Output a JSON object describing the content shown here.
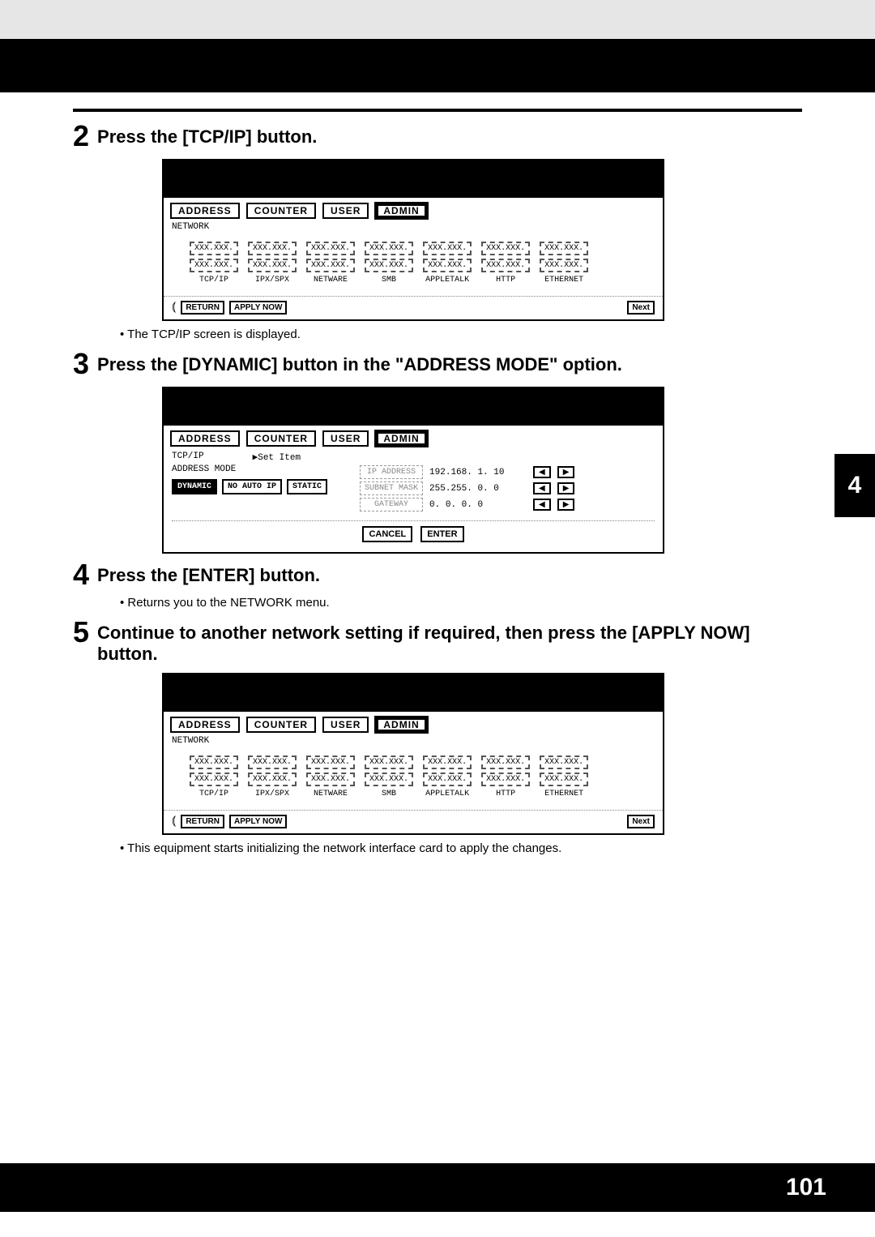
{
  "page_number": "101",
  "side_tab": "4",
  "steps": {
    "s2": {
      "num": "2",
      "title": "Press the [TCP/IP] button.",
      "bullet": "The TCP/IP screen is displayed."
    },
    "s3": {
      "num": "3",
      "title": "Press the [DYNAMIC] button in the \"ADDRESS MODE\" option."
    },
    "s4": {
      "num": "4",
      "title": "Press the [ENTER] button.",
      "bullet": "Returns you to the NETWORK menu."
    },
    "s5": {
      "num": "5",
      "title": "Continue to another network setting if required, then press the [APPLY NOW] button.",
      "bullet": "This equipment starts initializing the network interface card to apply the changes."
    }
  },
  "tabs": {
    "address": "ADDRESS",
    "counter": "COUNTER",
    "user": "USER",
    "admin": "ADMIN"
  },
  "network_label": "NETWORK",
  "placeholder": "XXX.XXX.",
  "net_items": [
    "TCP/IP",
    "IPX/SPX",
    "NETWARE",
    "SMB",
    "APPLETALK",
    "HTTP",
    "ETHERNET"
  ],
  "buttons": {
    "return": "RETURN",
    "apply": "APPLY NOW",
    "next": "Next",
    "cancel": "CANCEL",
    "enter": "ENTER"
  },
  "tcpip": {
    "title": "TCP/IP",
    "set_item": "▶Set Item",
    "mode_label": "ADDRESS MODE",
    "modes": {
      "dynamic": "DYNAMIC",
      "noauto": "NO AUTO IP",
      "static": "STATIC"
    },
    "fields": {
      "ip": {
        "label": "IP ADDRESS",
        "value": "192.168.  1. 10"
      },
      "mask": {
        "label": "SUBNET MASK",
        "value": "255.255.  0.  0"
      },
      "gw": {
        "label": "GATEWAY",
        "value": "  0.  0.  0.  0"
      }
    },
    "arrows": {
      "left": "◀",
      "right": "▶"
    }
  }
}
